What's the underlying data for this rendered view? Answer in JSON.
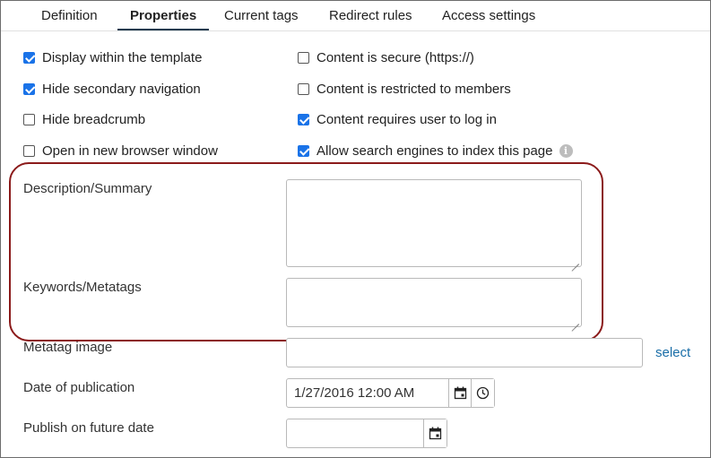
{
  "tabs": [
    {
      "label": "Definition",
      "active": false
    },
    {
      "label": "Properties",
      "active": true
    },
    {
      "label": "Current tags",
      "active": false
    },
    {
      "label": "Redirect rules",
      "active": false
    },
    {
      "label": "Access settings",
      "active": false
    }
  ],
  "options_left": [
    {
      "label": "Display within the template",
      "checked": true
    },
    {
      "label": "Hide secondary navigation",
      "checked": true
    },
    {
      "label": "Hide breadcrumb",
      "checked": false
    },
    {
      "label": "Open in new browser window",
      "checked": false
    }
  ],
  "options_right": [
    {
      "label": "Content is secure (https://)",
      "checked": false
    },
    {
      "label": "Content is restricted to members",
      "checked": false
    },
    {
      "label": "Content requires user to log in",
      "checked": true
    },
    {
      "label": "Allow search engines to index this page",
      "checked": true
    }
  ],
  "info_icon_glyph": "i",
  "fields": {
    "description_label": "Description/Summary",
    "description_value": "",
    "keywords_label": "Keywords/Metatags",
    "keywords_value": "",
    "metatag_image_label": "Metatag image",
    "metatag_image_value": "",
    "select_link": "select",
    "publication_label": "Date of publication",
    "publication_value": "1/27/2016 12:00 AM",
    "future_label": "Publish on future date",
    "future_value": ""
  },
  "colors": {
    "accent": "#1a73e8",
    "active_tab_underline": "#1d3b4f",
    "highlight_border": "#8b1a1a",
    "link": "#1a6ea8"
  }
}
